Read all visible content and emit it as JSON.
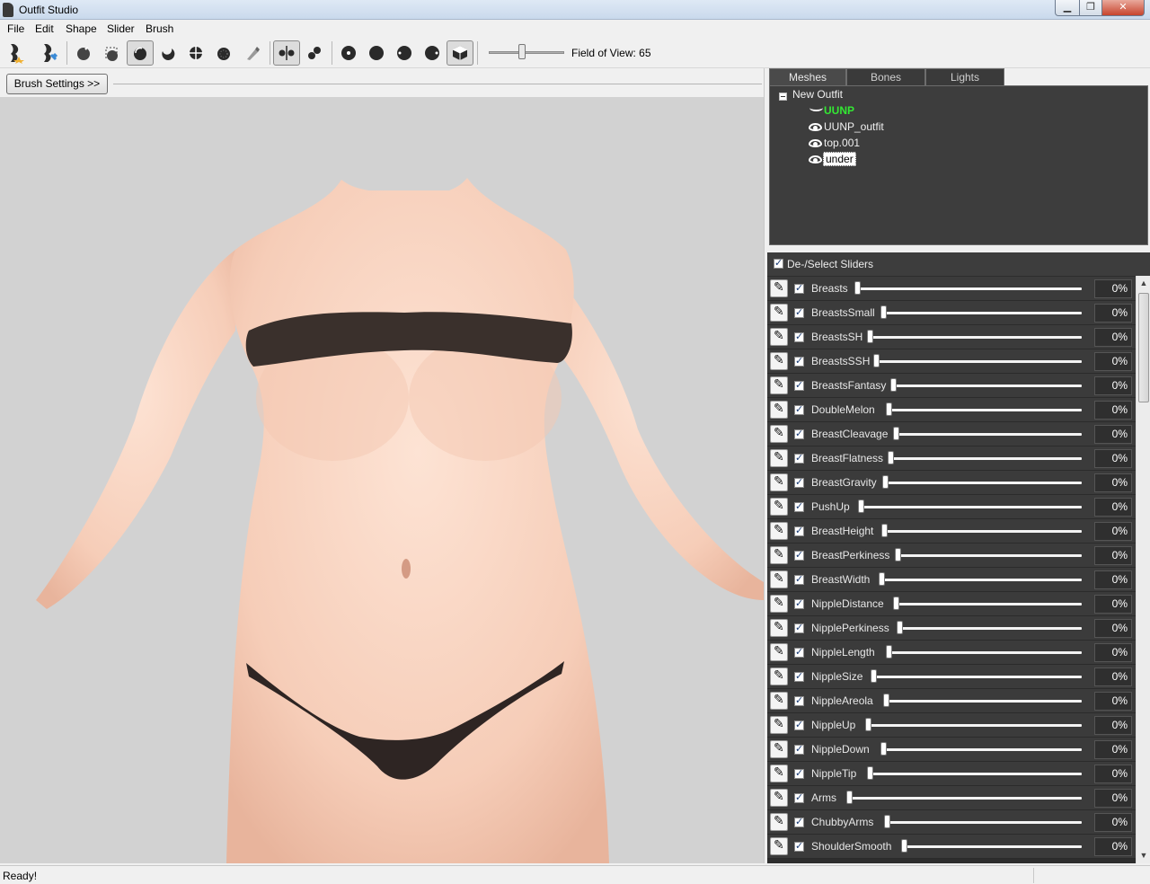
{
  "window": {
    "title": "Outfit Studio",
    "minimize": "▁",
    "maximize": "❐",
    "close": "✕"
  },
  "menu": [
    "File",
    "Edit",
    "Shape",
    "Slider",
    "Brush"
  ],
  "toolbar": {
    "icons": [
      "load-reference-icon",
      "load-outfit-icon",
      "select-tool-icon",
      "mask-tool-icon",
      "inflate-brush-icon",
      "deflate-brush-icon",
      "move-brush-icon",
      "smooth-brush-icon",
      "weight-brush-icon",
      "mirror-x-icon",
      "connected-only-icon",
      "brush-size-1-icon",
      "brush-size-2-icon",
      "brush-size-3-icon",
      "brush-size-4-icon",
      "view-cube-icon"
    ],
    "fov_label": "Field of View: 65",
    "fov_value": 65
  },
  "brush_settings_label": "Brush Settings >>",
  "tabs": [
    {
      "label": "Meshes",
      "active": true
    },
    {
      "label": "Bones",
      "active": false
    },
    {
      "label": "Lights",
      "active": false
    }
  ],
  "tree": {
    "root": "New Outfit",
    "items": [
      {
        "label": "UUNP",
        "visibility": "hidden",
        "color": "#33e833"
      },
      {
        "label": "UUNP_outfit",
        "visibility": "visible"
      },
      {
        "label": "top.001",
        "visibility": "visible"
      },
      {
        "label": "under",
        "visibility": "visible",
        "selected": true
      }
    ]
  },
  "sliders_header": "De-/Select Sliders",
  "sliders": [
    {
      "name": "Breasts",
      "value": "0%"
    },
    {
      "name": "BreastsSmall",
      "value": "0%"
    },
    {
      "name": "BreastsSH",
      "value": "0%"
    },
    {
      "name": "BreastsSSH",
      "value": "0%"
    },
    {
      "name": "BreastsFantasy",
      "value": "0%"
    },
    {
      "name": "DoubleMelon",
      "value": "0%"
    },
    {
      "name": "BreastCleavage",
      "value": "0%"
    },
    {
      "name": "BreastFlatness",
      "value": "0%"
    },
    {
      "name": "BreastGravity",
      "value": "0%"
    },
    {
      "name": "PushUp",
      "value": "0%"
    },
    {
      "name": "BreastHeight",
      "value": "0%"
    },
    {
      "name": "BreastPerkiness",
      "value": "0%"
    },
    {
      "name": "BreastWidth",
      "value": "0%"
    },
    {
      "name": "NippleDistance",
      "value": "0%"
    },
    {
      "name": "NipplePerkiness",
      "value": "0%"
    },
    {
      "name": "NippleLength",
      "value": "0%"
    },
    {
      "name": "NippleSize",
      "value": "0%"
    },
    {
      "name": "NippleAreola",
      "value": "0%"
    },
    {
      "name": "NippleUp",
      "value": "0%"
    },
    {
      "name": "NippleDown",
      "value": "0%"
    },
    {
      "name": "NippleTip",
      "value": "0%"
    },
    {
      "name": "Arms",
      "value": "0%"
    },
    {
      "name": "ChubbyArms",
      "value": "0%"
    },
    {
      "name": "ShoulderSmooth",
      "value": "0%"
    }
  ],
  "status": "Ready!"
}
